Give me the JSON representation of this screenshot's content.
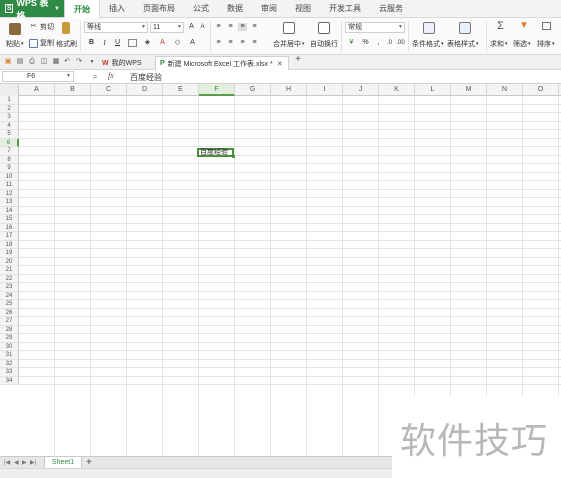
{
  "app": {
    "name": "WPS 表格"
  },
  "menu": {
    "tabs": [
      "开始",
      "插入",
      "页面布局",
      "公式",
      "数据",
      "审阅",
      "视图",
      "开发工具",
      "云服务"
    ],
    "active_tab": "开始"
  },
  "ribbon": {
    "paste": "粘贴",
    "cut": "剪切",
    "copy": "复制",
    "format_painter": "格式刷",
    "font_name": "等线",
    "font_size": "11",
    "merge_center": "合并居中",
    "wrap_text": "自动换行",
    "number_format": "常规",
    "conditional_format": "条件格式",
    "table_style": "表格样式",
    "sum": "求和",
    "filter": "筛选",
    "sort": "排序"
  },
  "doc_tabs": [
    {
      "label": "我的WPS",
      "active": false
    },
    {
      "label": "新建 Microsoft Excel 工作表.xlsx *",
      "active": true
    }
  ],
  "formula_bar": {
    "cell_ref": "F6",
    "fx": "fx",
    "content": "百度经验"
  },
  "grid": {
    "columns": [
      "A",
      "B",
      "C",
      "D",
      "E",
      "F",
      "G",
      "H",
      "I",
      "J",
      "K",
      "L",
      "M",
      "N",
      "O"
    ],
    "rows": [
      "1",
      "2",
      "3",
      "4",
      "5",
      "6",
      "7",
      "8",
      "9",
      "10",
      "11",
      "12",
      "13",
      "14",
      "15",
      "16",
      "17",
      "18",
      "19",
      "20",
      "21",
      "22",
      "23",
      "24",
      "25",
      "26",
      "27",
      "28",
      "29",
      "30",
      "31",
      "32",
      "33",
      "34"
    ],
    "selected_column": "F",
    "selected_row": "6",
    "active_cell_value": "百度经验"
  },
  "sheets": [
    "Sheet1"
  ],
  "active_sheet": "Sheet1",
  "watermark": "软件技巧",
  "colors": {
    "accent": "#2f8a43",
    "selection_border": "#4b8e3e",
    "header_selected": "#e3eedd"
  }
}
